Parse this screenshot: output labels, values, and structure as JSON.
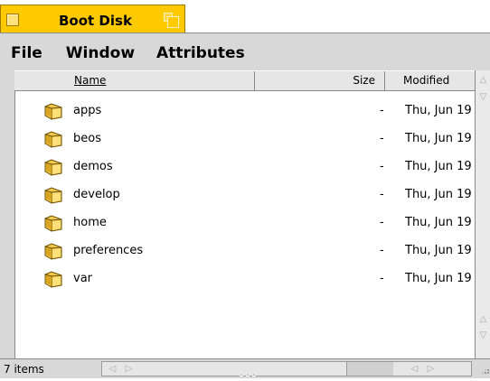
{
  "window": {
    "title": "Boot Disk",
    "accent_color": "#ffcb00"
  },
  "menubar": {
    "items": [
      "File",
      "Window",
      "Attributes"
    ]
  },
  "columns": {
    "name": "Name",
    "size": "Size",
    "modified": "Modified"
  },
  "files": [
    {
      "name": "apps",
      "size": "-",
      "modified": "Thu, Jun 19",
      "icon": "folder-icon"
    },
    {
      "name": "beos",
      "size": "-",
      "modified": "Thu, Jun 19",
      "icon": "folder-icon"
    },
    {
      "name": "demos",
      "size": "-",
      "modified": "Thu, Jun 19",
      "icon": "folder-icon"
    },
    {
      "name": "develop",
      "size": "-",
      "modified": "Thu, Jun 19",
      "icon": "folder-icon"
    },
    {
      "name": "home",
      "size": "-",
      "modified": "Thu, Jun 19",
      "icon": "folder-icon"
    },
    {
      "name": "preferences",
      "size": "-",
      "modified": "Thu, Jun 19",
      "icon": "folder-icon"
    },
    {
      "name": "var",
      "size": "-",
      "modified": "Thu, Jun 19",
      "icon": "folder-icon"
    }
  ],
  "status": {
    "item_count": "7 items"
  }
}
